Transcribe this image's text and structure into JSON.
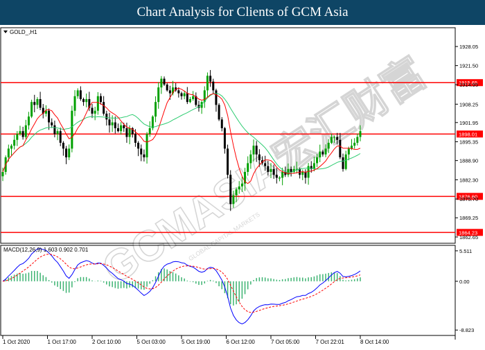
{
  "header": {
    "title": "Chart Analysis for Clients of GCM Asia"
  },
  "watermark": {
    "text": "GCMASIA宏汇财富",
    "subtext": "GLOBAL CAPITAL MARKETS"
  },
  "colors": {
    "header_bg": "#0e4565",
    "bull_candle": "#00a000",
    "bear_candle": "#000000",
    "ma_fast": "#ff0000",
    "ma_slow": "#2ecc71",
    "level_line": "#ff0000",
    "macd_line": "#0000ff",
    "signal_line": "#ff0000",
    "histogram": "#3cb371"
  },
  "chart_data": [
    {
      "type": "candlestick",
      "title": "GOLD_,H1",
      "ylim": [
        1860.5,
        1934.5
      ],
      "y_ticks": [
        "1928.05",
        "1921.50",
        "1914.95",
        "1908.25",
        "1901.95",
        "1895.35",
        "1888.90",
        "1882.30",
        "1875.70",
        "1869.25",
        "1862.65"
      ],
      "x_ticks": [
        "1 Oct 2020",
        "1 Oct 17:00",
        "2 Oct 10:00",
        "5 Oct 03:00",
        "5 Oct 19:00",
        "6 Oct 12:00",
        "7 Oct 05:00",
        "7 Oct 22:01",
        "8 Oct 14:00"
      ],
      "levels": [
        {
          "label": "1915.65",
          "value": 1915.65
        },
        {
          "label": "1898.01",
          "value": 1898.01
        },
        {
          "label": "1876.60",
          "value": 1876.6
        },
        {
          "label": "1864.23",
          "value": 1864.23
        }
      ],
      "close": [
        1885,
        1890,
        1893,
        1894,
        1896,
        1898,
        1899,
        1897,
        1901,
        1904,
        1909,
        1908,
        1910,
        1907,
        1905,
        1906,
        1902,
        1901,
        1898,
        1899,
        1895,
        1893,
        1890,
        1893,
        1906,
        1911,
        1913,
        1910,
        1909,
        1910,
        1907,
        1905,
        1906,
        1911,
        1909,
        1905,
        1903,
        1901,
        1902,
        1900,
        1899,
        1901,
        1900,
        1897,
        1900,
        1898,
        1895,
        1893,
        1891,
        1890,
        1898,
        1900,
        1904,
        1909,
        1914,
        1917,
        1915,
        1913,
        1912,
        1914,
        1913,
        1912,
        1911,
        1912,
        1909,
        1910,
        1911,
        1908,
        1907,
        1909,
        1913,
        1918,
        1916,
        1913,
        1908,
        1903,
        1900,
        1893,
        1884,
        1874,
        1877,
        1879,
        1880,
        1881,
        1885,
        1888,
        1891,
        1894,
        1891,
        1889,
        1888,
        1887,
        1885,
        1886,
        1884,
        1883,
        1883,
        1885,
        1884,
        1886,
        1885,
        1886,
        1886,
        1884,
        1885,
        1883,
        1887,
        1886,
        1888,
        1890,
        1892,
        1891,
        1893,
        1895,
        1897,
        1897,
        1896,
        1890,
        1886,
        1891,
        1893,
        1894,
        1895,
        1897,
        1899
      ]
    },
    {
      "type": "macd",
      "title": "MACD(12,26,9) 1.603 0.902 0.701",
      "ylim": [
        -9.8,
        6.5
      ],
      "y_ticks": [
        "5.511",
        "0.00",
        "-8.823"
      ],
      "macd_params": [
        12,
        26,
        9
      ]
    }
  ]
}
